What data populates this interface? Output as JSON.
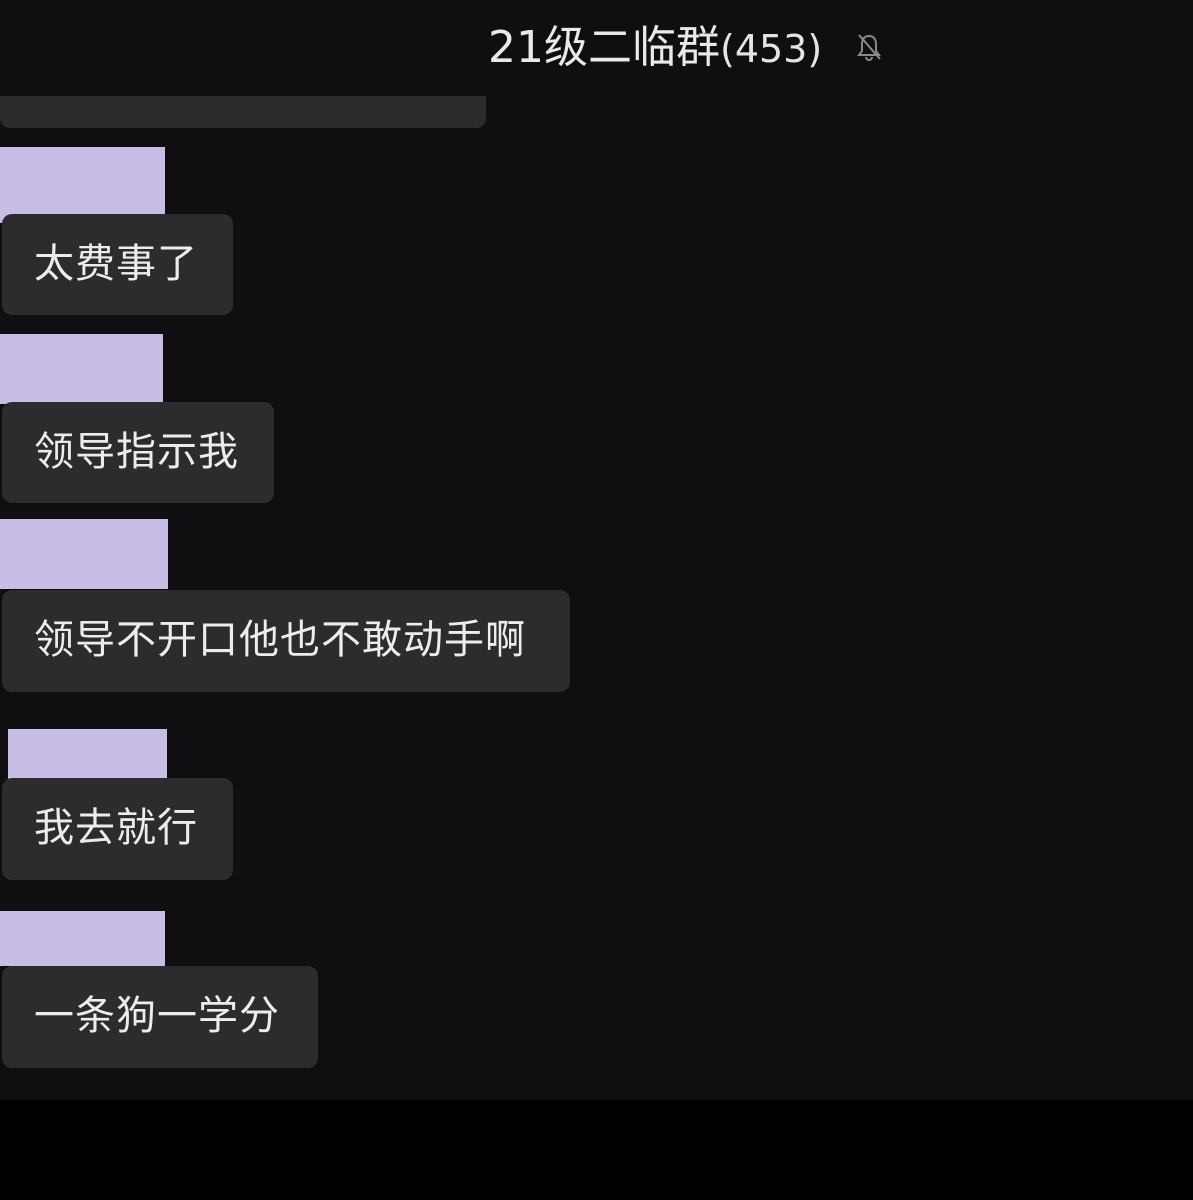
{
  "header": {
    "group_name": "21级二临群",
    "member_count": "(453)",
    "mute_icon": "bell-slash-icon"
  },
  "messages": [
    {
      "text": "太费事了"
    },
    {
      "text": "领导指示我"
    },
    {
      "text": "领导不开口他也不敢动手啊"
    },
    {
      "text": "我去就行"
    },
    {
      "text": "一条狗一学分"
    }
  ],
  "colors": {
    "background": "#0f0e10",
    "bubble": "#2c2b2d",
    "name_redaction": "#c9bde6",
    "text": "#ececec"
  }
}
